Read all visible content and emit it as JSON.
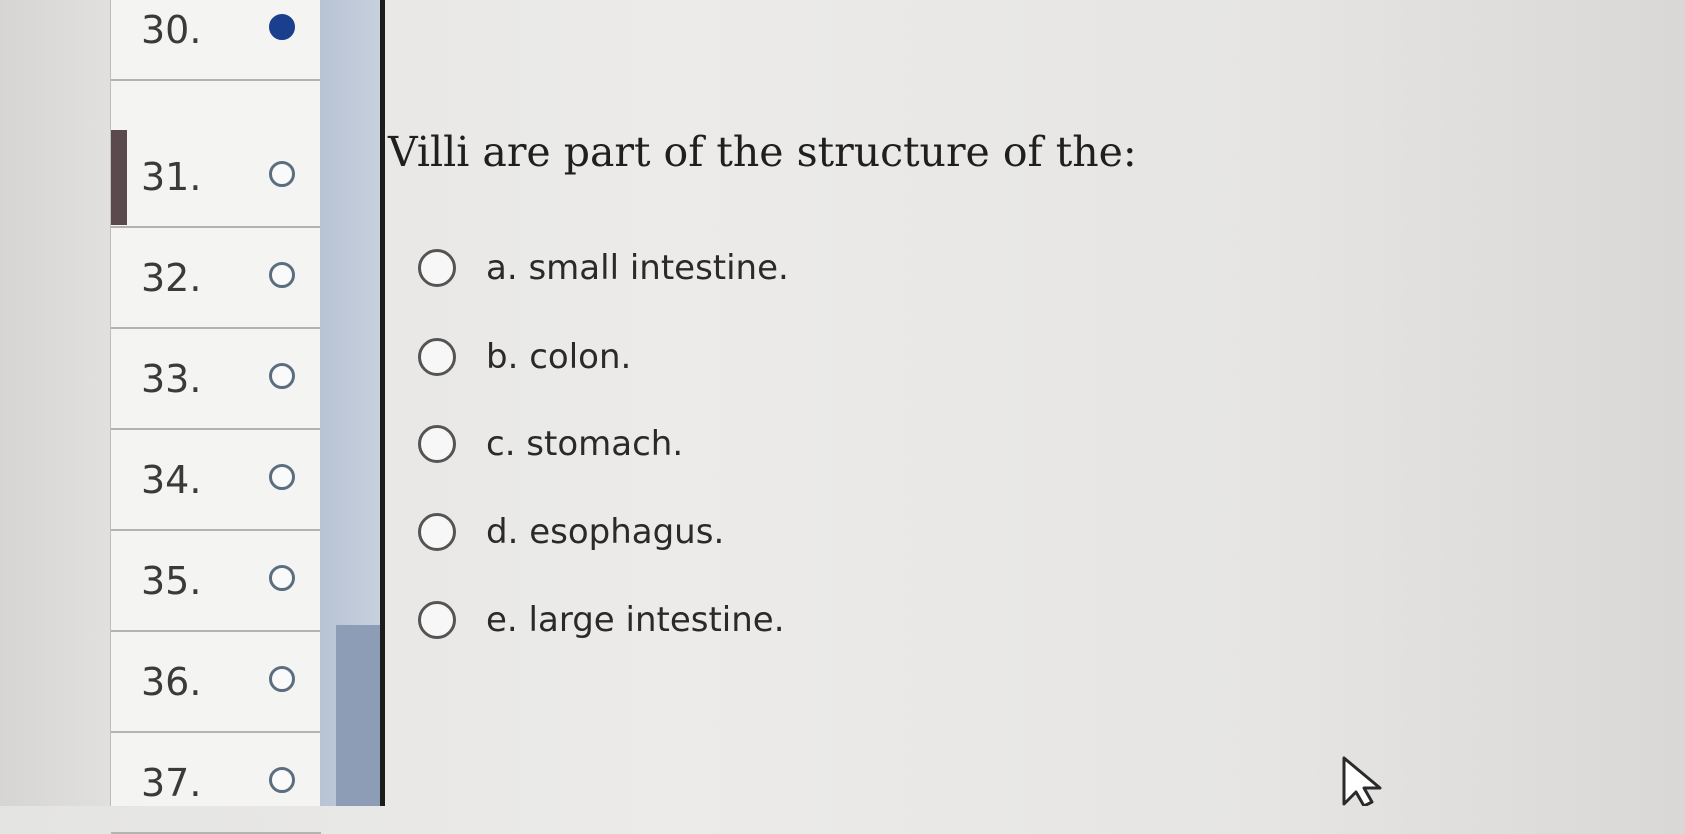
{
  "question_nav": {
    "items": [
      {
        "number": "30.",
        "state": "answered"
      },
      {
        "number": "31.",
        "state": "current"
      },
      {
        "number": "32.",
        "state": "unanswered"
      },
      {
        "number": "33.",
        "state": "unanswered"
      },
      {
        "number": "34.",
        "state": "unanswered"
      },
      {
        "number": "35.",
        "state": "unanswered"
      },
      {
        "number": "36.",
        "state": "unanswered"
      },
      {
        "number": "37.",
        "state": "unanswered"
      }
    ]
  },
  "question": {
    "text": "Villi are part of the structure of the:",
    "options": [
      {
        "label": "a. small intestine.",
        "selected": false
      },
      {
        "label": "b. colon.",
        "selected": false
      },
      {
        "label": "c. stomach.",
        "selected": false
      },
      {
        "label": "d. esophagus.",
        "selected": false
      },
      {
        "label": "e. large intestine.",
        "selected": false
      }
    ]
  },
  "colors": {
    "answered_indicator": "#1a3f8c",
    "current_marker": "#5b4a4d",
    "scrollbar": "#8e9db6"
  },
  "icons": {
    "cursor": "mouse-pointer-icon"
  }
}
